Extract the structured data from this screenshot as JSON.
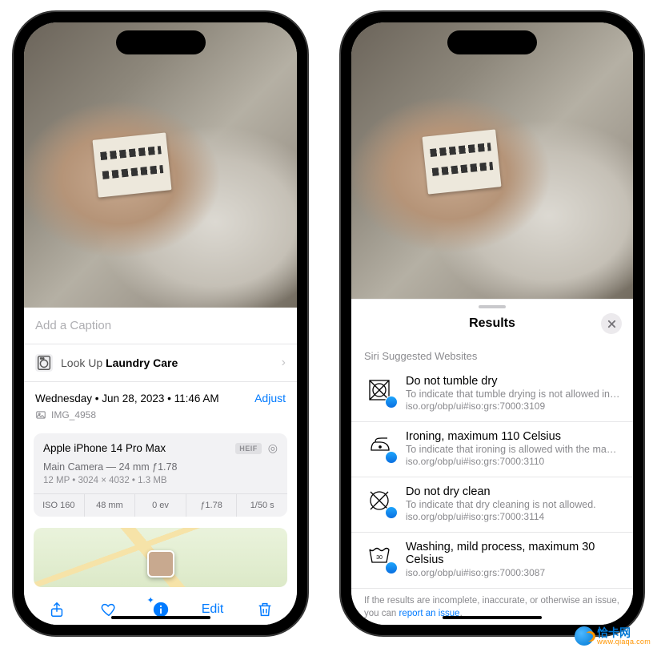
{
  "left": {
    "caption_placeholder": "Add a Caption",
    "lookup": {
      "prefix": "Look Up ",
      "term": "Laundry Care"
    },
    "datetime": {
      "weekday": "Wednesday",
      "date": "Jun 28, 2023",
      "time": "11:46 AM",
      "adjust": "Adjust"
    },
    "filename": "IMG_4958",
    "camera": {
      "device": "Apple iPhone 14 Pro Max",
      "format_badge": "HEIF",
      "lens_line": "Main Camera — 24 mm ƒ1.78",
      "meta_line": "12 MP  •  3024 × 4032  •  1.3 MB",
      "exif": [
        "ISO 160",
        "48 mm",
        "0 ev",
        "ƒ1.78",
        "1/50 s"
      ]
    },
    "toolbar": {
      "edit": "Edit"
    }
  },
  "right": {
    "title": "Results",
    "section": "Siri Suggested Websites",
    "results": [
      {
        "title": "Do not tumble dry",
        "desc": "To indicate that tumble drying is not allowed in the...",
        "url": "iso.org/obp/ui#iso:grs:7000:3109"
      },
      {
        "title": "Ironing, maximum 110 Celsius",
        "desc": "To indicate that ironing is allowed with the maximu...",
        "url": "iso.org/obp/ui#iso:grs:7000:3110"
      },
      {
        "title": "Do not dry clean",
        "desc": "To indicate that dry cleaning is not allowed.",
        "url": "iso.org/obp/ui#iso:grs:7000:3114"
      },
      {
        "title": "Washing, mild process, maximum 30 Celsius",
        "desc": "",
        "url": "iso.org/obp/ui#iso:grs:7000:3087"
      }
    ],
    "footer": {
      "text": "If the results are incomplete, inaccurate, or otherwise an issue, you can ",
      "link": "report an issue"
    }
  },
  "watermark": {
    "cn": "恰卡网",
    "domain": "www.qiaqa.com"
  }
}
